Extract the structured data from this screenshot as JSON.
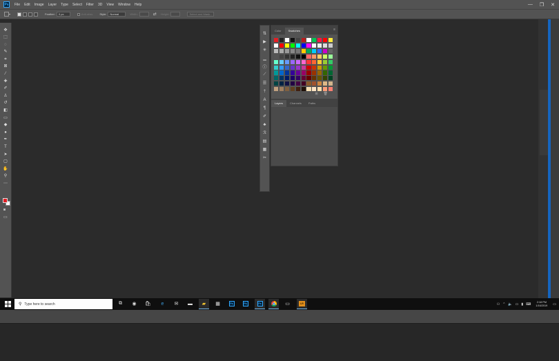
{
  "app": {
    "logo": "Ps"
  },
  "menu": [
    "File",
    "Edit",
    "Image",
    "Layer",
    "Type",
    "Select",
    "Filter",
    "3D",
    "View",
    "Window",
    "Help"
  ],
  "window_controls": {
    "minimize": "—",
    "restore": "❐",
    "close": "✕"
  },
  "options": {
    "feather_label": "Feather:",
    "feather_value": "0 px",
    "antialias_label": "Anti-alias",
    "style_label": "Style:",
    "style_value": "Normal",
    "width_label": "Width:",
    "height_label": "Height:",
    "select_mask_label": "Select and Mask..."
  },
  "swatches_panel": {
    "tabs": [
      "Color",
      "Swatches"
    ],
    "active_tab": "Swatches",
    "colors": [
      [
        "#e31e24",
        "#222222",
        "#ffffff",
        "#111111",
        "#444444",
        "#b71c1c",
        "#ffffff",
        "#00c853",
        "#ff1744",
        "#ff0000",
        "#ffeb3b"
      ],
      [
        "#ffffff",
        "#ff0000",
        "#ffff00",
        "#00ff00",
        "#00ffff",
        "#0000ff",
        "#ff00ff",
        "#ffffff",
        "#eeeeee",
        "#dddddd",
        "#cccccc"
      ],
      [
        "#bbbbbb",
        "#aaaaaa",
        "#999999",
        "#888888",
        "#777777",
        "#ffcc00",
        "#00aa55",
        "#00ccff",
        "#3366ff",
        "#cc00cc",
        "#666666"
      ],
      [
        "#555555",
        "#444444",
        "#333333",
        "#222222",
        "#111111",
        "#000000",
        "#ff6666",
        "#ff9966",
        "#ffcc66",
        "#ccff66",
        "#99ff99"
      ],
      [
        "#66ffcc",
        "#66ccff",
        "#6699ff",
        "#9966ff",
        "#cc66ff",
        "#ff66cc",
        "#ff3333",
        "#ff6633",
        "#ffcc33",
        "#99cc33",
        "#33cc66"
      ],
      [
        "#33cccc",
        "#3399ff",
        "#3366cc",
        "#6633cc",
        "#9933cc",
        "#cc3399",
        "#cc0000",
        "#cc3300",
        "#cc9900",
        "#669900",
        "#009933"
      ],
      [
        "#009999",
        "#0066cc",
        "#003399",
        "#330099",
        "#660099",
        "#990066",
        "#990000",
        "#993300",
        "#996600",
        "#336600",
        "#006633"
      ],
      [
        "#006666",
        "#003366",
        "#001a66",
        "#1a0066",
        "#330066",
        "#660033",
        "#660000",
        "#663300",
        "#665500",
        "#334400",
        "#004422"
      ],
      [
        "#004444",
        "#002244",
        "#111144",
        "#220044",
        "#440044",
        "#440022",
        "#8b5a2b",
        "#a0522d",
        "#cd853f",
        "#deb887",
        "#d2b48c"
      ],
      [
        "#c0a080",
        "#a08060",
        "#806040",
        "#604020",
        "#402010",
        "#201008",
        "#f5deb3",
        "#ffe4c4",
        "#ffdead",
        "#ffa07a",
        "#fa8072"
      ]
    ]
  },
  "panel_bottom": {
    "new_icon": "⊞",
    "delete_icon": "🗑"
  },
  "layers_panel": {
    "tabs": [
      "Layers",
      "Channels",
      "Paths"
    ],
    "active_tab": "Layers"
  },
  "taskbar": {
    "search_placeholder": "Type here to search",
    "clock_time": "2:18 PM",
    "clock_date": "1/16/2019"
  },
  "icons": {
    "start": "windows-icon",
    "search": "search-icon"
  }
}
